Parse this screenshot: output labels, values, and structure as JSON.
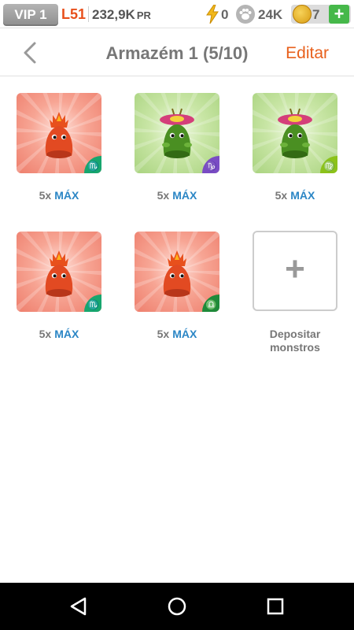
{
  "status_bar": {
    "vip_label": "VIP 1",
    "level": "L51",
    "power": "232,9K",
    "power_unit": "PR",
    "energy": "0",
    "food": "24K",
    "coins": "7",
    "add_label": "+"
  },
  "header": {
    "title": "Armazém 1 (5/10)",
    "edit_label": "Editar"
  },
  "slots": [
    {
      "count": "5x",
      "max": "MÁX",
      "element": "fire",
      "zodiac": "♏",
      "zodiac_color": "#17a66e"
    },
    {
      "count": "5x",
      "max": "MÁX",
      "element": "nature",
      "zodiac": "♑",
      "zodiac_color": "#7a4cc4"
    },
    {
      "count": "5x",
      "max": "MÁX",
      "element": "nature",
      "zodiac": "♍",
      "zodiac_color": "#8cc21a"
    },
    {
      "count": "5x",
      "max": "MÁX",
      "element": "fire",
      "zodiac": "♏",
      "zodiac_color": "#17a66e"
    },
    {
      "count": "5x",
      "max": "MÁX",
      "element": "fire",
      "zodiac": "♎",
      "zodiac_color": "#1e8a3a"
    }
  ],
  "deposit": {
    "plus": "+",
    "line1": "Depositar",
    "line2": "monstros"
  },
  "colors": {
    "accent_orange": "#e8601c",
    "max_blue": "#2b86c5",
    "green_button": "#46b84a"
  }
}
